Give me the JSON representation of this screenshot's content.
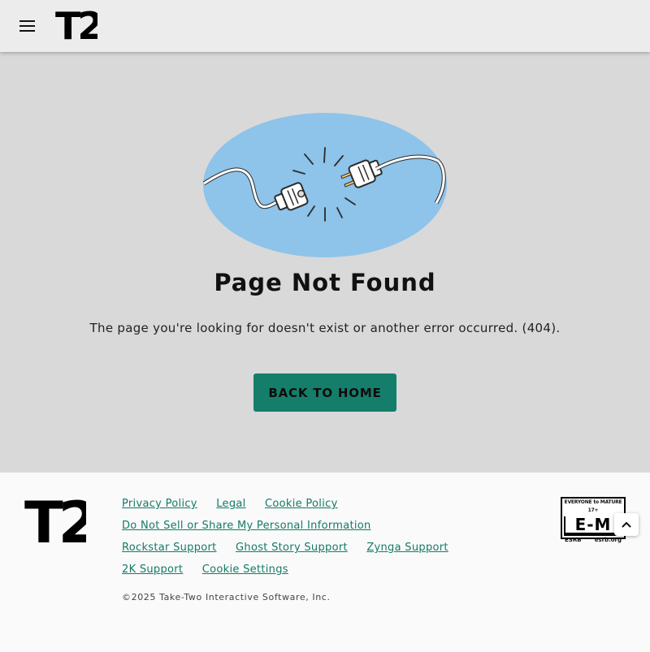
{
  "header": {
    "menu_icon": "hamburger-menu-icon",
    "logo_text": "T2"
  },
  "main": {
    "illustration_icon": "unplugged-cable-icon",
    "title": "Page Not Found",
    "message": "The page you're looking for doesn't exist or another error occurred. (404).",
    "button_label": "BACK TO HOME"
  },
  "footer": {
    "logo_text": "T2",
    "links": [
      [
        "Privacy Policy",
        "Legal",
        "Cookie Policy"
      ],
      [
        "Do Not Sell or Share My Personal Information"
      ],
      [
        "Rockstar Support",
        "Ghost Story Support",
        "Zynga Support"
      ],
      [
        "2K Support",
        "Cookie Settings"
      ]
    ],
    "copyright": "©2025 Take-Two Interactive Software, Inc.",
    "esrb": {
      "top": "EVERYONE to MATURE 17+",
      "rating": "E-M",
      "left": "ESRB",
      "right": "esrb.org"
    }
  },
  "scroll_top_icon": "chevron-up-icon",
  "colors": {
    "accent": "#157e6a",
    "link": "#147a66",
    "illustration_bg": "#8ec3ea",
    "page_bg": "#d9d9d9"
  }
}
